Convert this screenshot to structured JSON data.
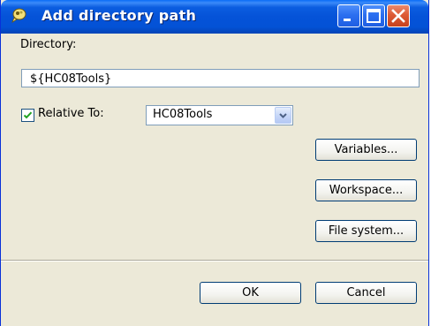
{
  "window": {
    "title": "Add directory path",
    "title_icon": "eclipse-dialog-icon",
    "controls": [
      "minimize-icon",
      "maximize-icon",
      "close-icon"
    ]
  },
  "directory": {
    "label": "Directory:",
    "value": "${HC08Tools}"
  },
  "relative": {
    "checked": true,
    "label": "Relative To:",
    "selected": "HC08Tools"
  },
  "side_buttons": {
    "variables": "Variables...",
    "workspace": "Workspace...",
    "file_system": "File system..."
  },
  "footer": {
    "ok": "OK",
    "cancel": "Cancel"
  },
  "colors": {
    "titlebar": "#0553d8",
    "dialog_bg": "#ece9d8",
    "close_button": "#dd5a35",
    "button_border": "#003c74",
    "checkmark": "#21a121"
  }
}
